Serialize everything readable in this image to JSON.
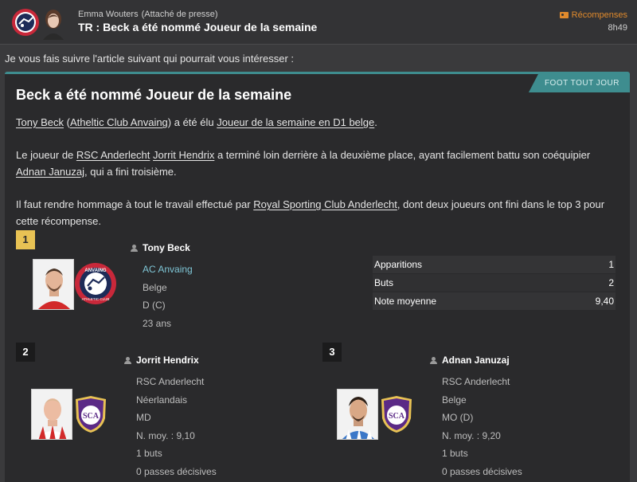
{
  "header": {
    "sender_name": "Emma Wouters",
    "sender_role": "(Attaché de presse)",
    "subject": "TR : Beck a été nommé Joueur de la semaine",
    "rewards_label": "Récompenses",
    "time": "8h49",
    "club_logo_icon": "club-crest-icon",
    "avatar_icon": "press-officer-avatar"
  },
  "intro": "Je vous fais suivre l'article suivant qui pourrait vous intéresser :",
  "article": {
    "source": "FOOT TOUT JOUR",
    "title": "Beck a été nommé Joueur de la semaine",
    "p1": {
      "link1": "Tony Beck",
      "t1": " (",
      "link2": "Atheltic Club Anvaing",
      "t2": ") a été élu ",
      "link3": "Joueur de la semaine en D1 belge",
      "t3": "."
    },
    "p2": {
      "t1": "Le joueur de ",
      "link1": "RSC Anderlecht",
      "t2": " ",
      "link2": "Jorrit Hendrix",
      "t3": " a terminé loin derrière à la deuxième place, ayant facilement battu son coéquipier ",
      "link3": "Adnan Januzaj",
      "t4": ", qui a fini troisième."
    },
    "p3": {
      "t1": "Il faut rendre hommage à tout le travail effectué par ",
      "link1": "Royal Sporting Club Anderlecht",
      "t2": ", dont deux joueurs ont fini dans le top 3 pour cette récompense."
    }
  },
  "anvaing_crest": {
    "top": "ANVAING",
    "bottom": "ATHLETIC CLUB"
  },
  "anderlecht_crest": {
    "letters": "SCA"
  },
  "players": [
    {
      "rank": "1",
      "name": "Tony Beck",
      "club": "AC Anvaing",
      "nationality": "Belge",
      "position": "D (C)",
      "age": "23 ans",
      "stats": [
        {
          "label": "Apparitions",
          "value": "1"
        },
        {
          "label": "Buts",
          "value": "2"
        },
        {
          "label": "Note moyenne",
          "value": "9,40"
        }
      ]
    },
    {
      "rank": "2",
      "name": "Jorrit Hendrix",
      "club": "RSC Anderlecht",
      "nationality": "Néerlandais",
      "position": "MD",
      "avg_rating": "N. moy. : 9,10",
      "goals": "1 buts",
      "assists": "0 passes décisives"
    },
    {
      "rank": "3",
      "name": "Adnan Januzaj",
      "club": "RSC Anderlecht",
      "nationality": "Belge",
      "position": "MO (D)",
      "avg_rating": "N. moy. : 9,20",
      "goals": "1 buts",
      "assists": "0 passes décisives"
    }
  ],
  "colors": {
    "accent": "#3e8d8f",
    "gold": "#e8c254",
    "rewards": "#e08a2c",
    "club_link": "#7fc6d6"
  }
}
